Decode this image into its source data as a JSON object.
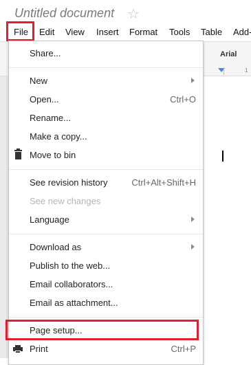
{
  "document": {
    "title": "Untitled document",
    "star_icon": "star-icon"
  },
  "menubar": {
    "items": [
      "File",
      "Edit",
      "View",
      "Insert",
      "Format",
      "Tools",
      "Table",
      "Add-"
    ]
  },
  "toolbar": {
    "font_name": "Arial",
    "ruler_tick": "1"
  },
  "highlight_color": "#e0202e",
  "file_menu": {
    "share": "Share...",
    "new": "New",
    "open": "Open...",
    "open_shortcut": "Ctrl+O",
    "rename": "Rename...",
    "make_copy": "Make a copy...",
    "move_to_bin": "Move to bin",
    "revision_history": "See revision history",
    "revision_shortcut": "Ctrl+Alt+Shift+H",
    "new_changes": "See new changes",
    "language": "Language",
    "download_as": "Download as",
    "publish": "Publish to the web...",
    "email_collaborators": "Email collaborators...",
    "email_attachment": "Email as attachment...",
    "page_setup": "Page setup...",
    "print": "Print",
    "print_shortcut": "Ctrl+P"
  }
}
